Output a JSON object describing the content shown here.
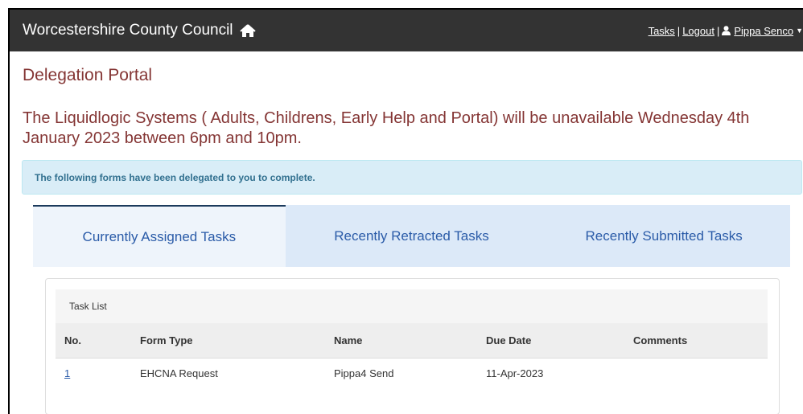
{
  "navbar": {
    "brand": "Worcestershire County Council",
    "tasks_link": "Tasks",
    "separator": "|",
    "logout_link": "Logout",
    "user_name": "Pippa Senco",
    "home_icon": "home-icon",
    "user_icon": "user-icon",
    "caret_icon": "caret-down-icon"
  },
  "page": {
    "title": "Delegation Portal",
    "announcement": "The Liquidlogic Systems ( Adults, Childrens, Early Help and Portal) will be unavailable Wednesday 4th January 2023 between 6pm and 10pm.",
    "info_message": "The following forms have been delegated to you to complete."
  },
  "tabs": [
    {
      "label": "Currently Assigned Tasks",
      "active": true
    },
    {
      "label": "Recently Retracted Tasks",
      "active": false
    },
    {
      "label": "Recently Submitted Tasks",
      "active": false
    }
  ],
  "task_list": {
    "heading": "Task List",
    "columns": [
      "No.",
      "Form Type",
      "Name",
      "Due Date",
      "Comments"
    ],
    "rows": [
      {
        "no": "1",
        "form_type": "EHCNA Request",
        "name": "Pippa4 Send",
        "due_date": "11-Apr-2023",
        "comments": ""
      }
    ]
  },
  "colors": {
    "navbar_bg": "#333333",
    "title_color": "#843534",
    "info_bg": "#d9edf7",
    "info_text": "#31708f",
    "link_color": "#2a5ba8"
  }
}
